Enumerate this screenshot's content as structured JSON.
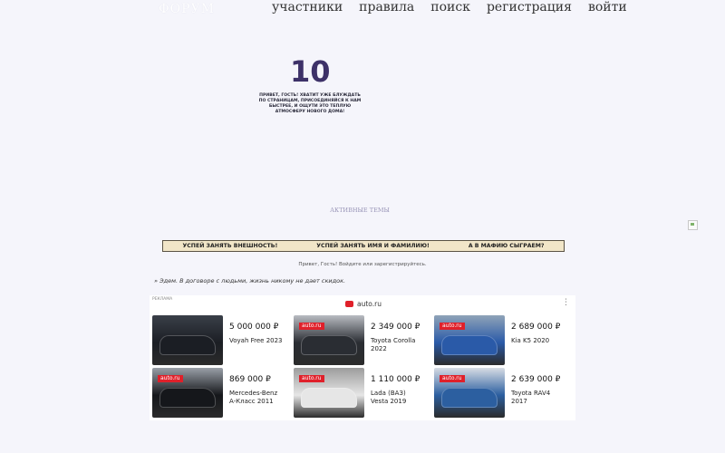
{
  "header": {
    "logo_text": "ФОРУМ",
    "nav": [
      "участники",
      "правила",
      "поиск",
      "регистрация",
      "войти"
    ]
  },
  "banner": {
    "number": "10",
    "text": "привет, гость! хватит уже блуждать по страницам, присоединяйся к нам быстрее, и ощути это теплую атмосферу нового дома!"
  },
  "active_topics_label": "активные темы",
  "promo_bar": [
    "успей занять внешность!",
    "успей занять имя и фамилию!",
    "а в мафию сыграем?"
  ],
  "greeting": "Привет, Гость!  Войдите или зарегистрируйтесь.",
  "quote": "» Эдем. В договоре с людьми, жизнь никому не дает скидок.",
  "ad": {
    "label": "реклама",
    "brand": "auto.ru",
    "menu_icon": "more-vertical-icon",
    "photo_tag": "auto.ru",
    "cards": [
      {
        "price": "5 000 000 ₽",
        "name": "Voyah Free 2023",
        "tagged": false,
        "colors": [
          "#1b1e24",
          "#3a3f48"
        ]
      },
      {
        "price": "2 349 000 ₽",
        "name": "Toyota Corolla 2022",
        "tagged": true,
        "colors": [
          "#2a2d33",
          "#b9bcc2"
        ]
      },
      {
        "price": "2 689 000 ₽",
        "name": "Kia K5 2020",
        "tagged": true,
        "colors": [
          "#2a5aa8",
          "#8fa3b8"
        ]
      },
      {
        "price": "869 000 ₽",
        "name": "Mercedes-Benz A-Класс 2011",
        "tagged": true,
        "colors": [
          "#15171b",
          "#9aa0a8"
        ]
      },
      {
        "price": "1 110 000 ₽",
        "name": "Lada (ВАЗ) Vesta 2019",
        "tagged": true,
        "colors": [
          "#e6e6e6",
          "#9c9c9c"
        ]
      },
      {
        "price": "2 639 000 ₽",
        "name": "Toyota RAV4 2017",
        "tagged": true,
        "colors": [
          "#2c5fa0",
          "#d8dde4"
        ]
      }
    ]
  },
  "colors": {
    "background": "#f5f5fb",
    "banner_number": "#3d3168",
    "promo_bar_bg": "#f1e6c8",
    "ad_brand_red": "#e0202a"
  }
}
